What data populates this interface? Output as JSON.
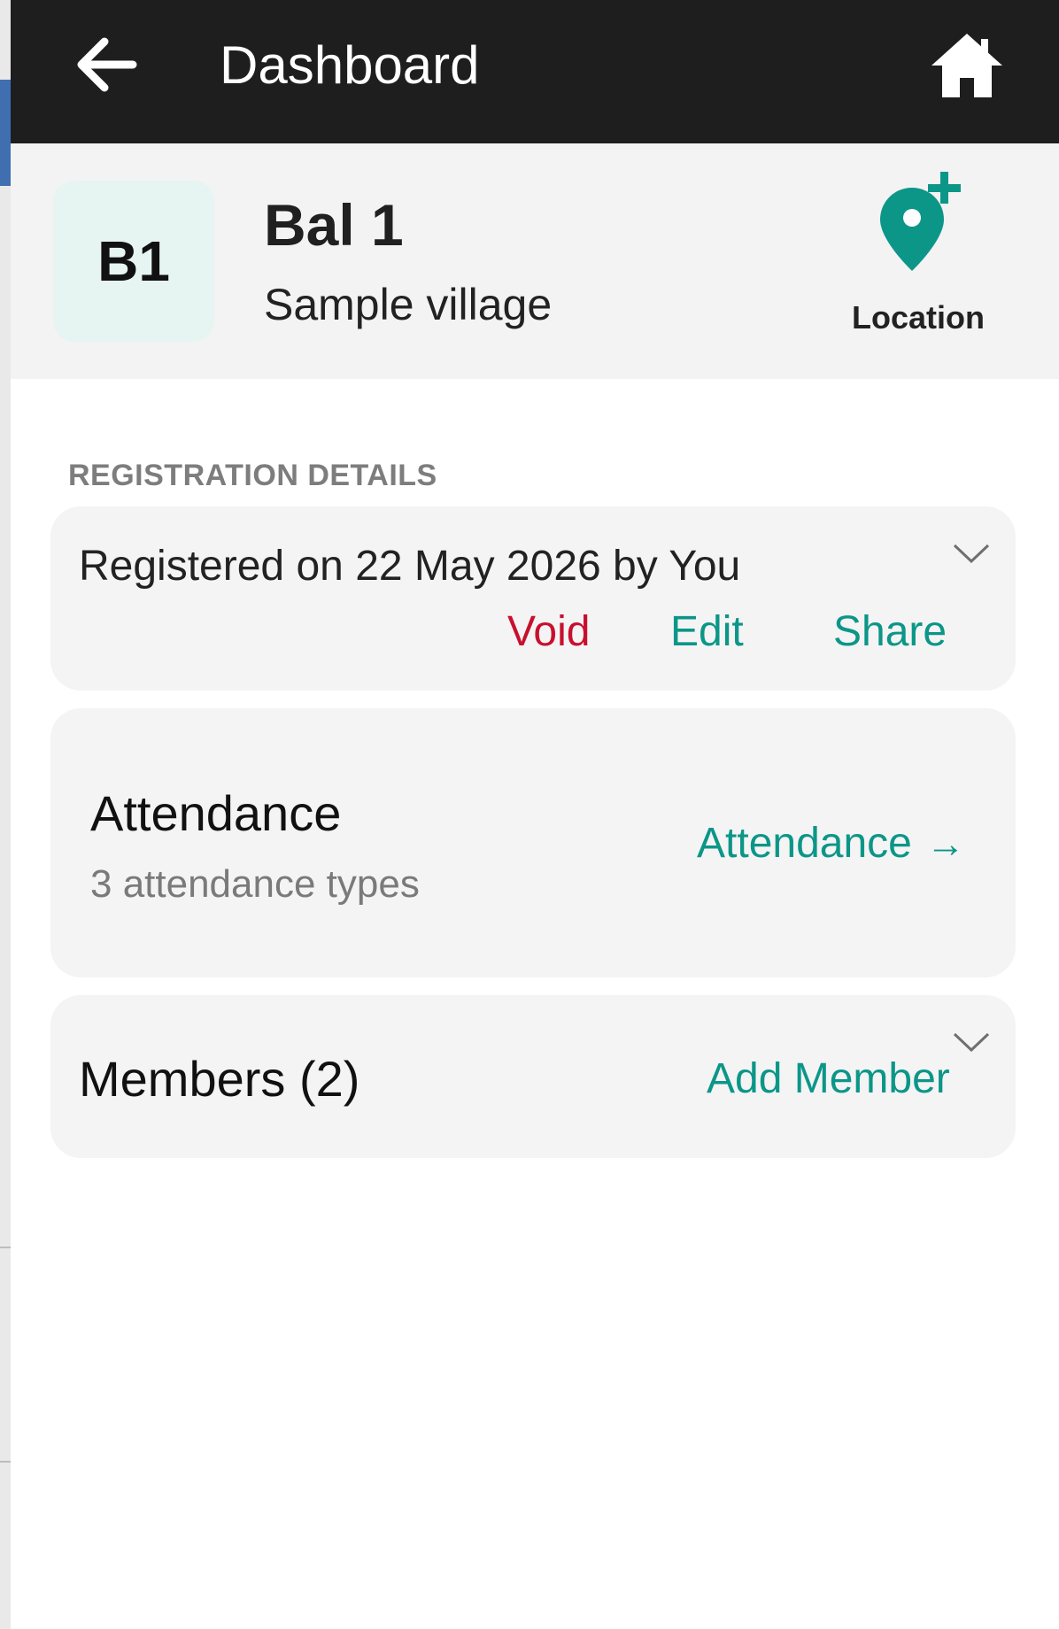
{
  "appbar": {
    "title": "Dashboard",
    "back_icon": "arrow-left-icon",
    "home_icon": "home-icon"
  },
  "subject": {
    "avatar_initials": "B1",
    "name": "Bal 1",
    "location_subtitle": "Sample village",
    "location_button_label": "Location",
    "location_icon": "map-pin-plus-icon"
  },
  "registration": {
    "section_title": "REGISTRATION DETAILS",
    "summary": "Registered on 22 May 2026 by You",
    "void_label": "Void",
    "edit_label": "Edit",
    "share_label": "Share"
  },
  "attendance": {
    "title": "Attendance",
    "subtitle": "3 attendance types",
    "link_label": "Attendance",
    "link_arrow": "→"
  },
  "members": {
    "title": "Members (2)",
    "add_label": "Add Member"
  },
  "colors": {
    "accent": "#0b9688",
    "danger": "#c8102e",
    "appbar_bg": "#1e1e1e",
    "header_bg": "#f3f3f3",
    "card_bg": "#f4f4f4"
  }
}
